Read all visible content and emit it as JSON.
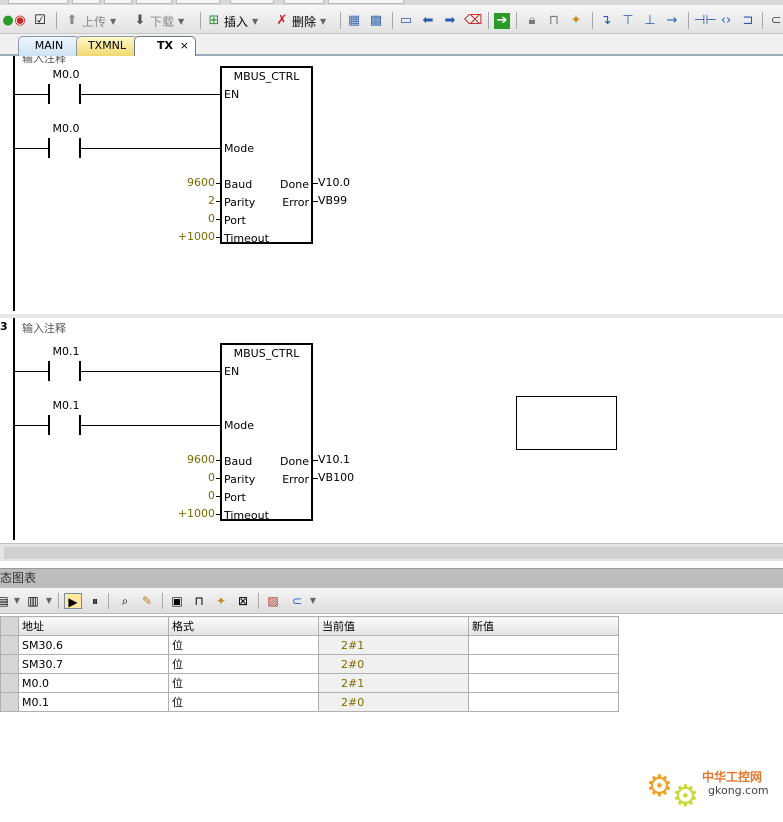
{
  "toolbar": {
    "upload_label": "上传",
    "download_label": "下载",
    "insert_label": "插入",
    "delete_label": "删除"
  },
  "tabs": [
    {
      "label": "MAIN"
    },
    {
      "label": "TXMNL"
    },
    {
      "label": "TX",
      "active": true,
      "close": "×"
    }
  ],
  "networks": [
    {
      "comment": "输入注释",
      "contact_en": "M0.0",
      "contact_mode": "M0.0",
      "block": {
        "title": "MBUS_CTRL",
        "pins_in": [
          "EN",
          "Mode",
          "Baud",
          "Parity",
          "Port",
          "Timeout"
        ],
        "pins_out": [
          "Done",
          "Error"
        ],
        "baud": "9600",
        "parity": "2",
        "port": "0",
        "timeout": "+1000",
        "done": "V10.0",
        "error": "VB99"
      }
    },
    {
      "number": "3",
      "comment": "输入注释",
      "contact_en": "M0.1",
      "contact_mode": "M0.1",
      "block": {
        "title": "MBUS_CTRL",
        "pins_in": [
          "EN",
          "Mode",
          "Baud",
          "Parity",
          "Port",
          "Timeout"
        ],
        "pins_out": [
          "Done",
          "Error"
        ],
        "baud": "9600",
        "parity": "0",
        "port": "0",
        "timeout": "+1000",
        "done": "V10.1",
        "error": "VB100"
      }
    }
  ],
  "status_chart": {
    "title": "态图表",
    "columns": [
      "地址",
      "格式",
      "当前值",
      "新值"
    ],
    "rows": [
      {
        "address": "SM30.6",
        "format": "位",
        "current": "2#1",
        "new": ""
      },
      {
        "address": "SM30.7",
        "format": "位",
        "current": "2#0",
        "new": ""
      },
      {
        "address": "M0.0",
        "format": "位",
        "current": "2#1",
        "new": ""
      },
      {
        "address": "M0.1",
        "format": "位",
        "current": "2#0",
        "new": ""
      }
    ]
  },
  "watermark": {
    "brand": "中华工控网",
    "url": "gkong.com"
  },
  "colors": {
    "value_text": "#7a6a00",
    "txmnl_tab": "#f0d870",
    "panel_title_bg": "#bdbdbd"
  }
}
